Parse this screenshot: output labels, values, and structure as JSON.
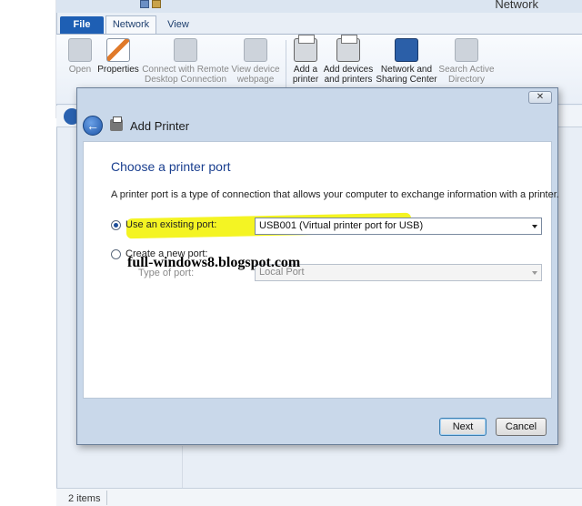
{
  "explorer": {
    "window_title": "Network",
    "tabs": [
      "File",
      "Network",
      "View"
    ],
    "ribbon_buttons": [
      {
        "label": "Open",
        "icon": "open-icon",
        "enabled": false
      },
      {
        "label": "Properties",
        "icon": "properties-icon",
        "enabled": true
      },
      {
        "label": "Connect with Remote Desktop Connection",
        "icon": "remote-desktop-icon",
        "enabled": false
      },
      {
        "label": "View device webpage",
        "icon": "device-webpage-icon",
        "enabled": false
      },
      {
        "label": "Add a printer",
        "icon": "printer-icon",
        "enabled": true
      },
      {
        "label": "Add devices and printers",
        "icon": "devices-printers-icon",
        "enabled": true
      },
      {
        "label": "Network and Sharing Center",
        "icon": "network-center-icon",
        "enabled": true
      },
      {
        "label": "Search Active Directory",
        "icon": "active-directory-icon",
        "enabled": false
      }
    ],
    "status": "2 items"
  },
  "dialog": {
    "title": "Add Printer",
    "close_glyph": "✕",
    "back_glyph": "←",
    "heading": "Choose a printer port",
    "description": "A printer port is a type of connection that allows your computer to exchange information with a printer.",
    "options": {
      "existing": {
        "label": "Use an existing port:",
        "selected": true,
        "value": "USB001 (Virtual printer port for USB)"
      },
      "new": {
        "label": "Create a new port:",
        "selected": false,
        "type_label": "Type of port:",
        "type_value": "Local Port"
      }
    },
    "buttons": {
      "next": "Next",
      "cancel": "Cancel"
    },
    "highlight_color": "#f4f423"
  },
  "watermark": "full-windows8.blogspot.com"
}
